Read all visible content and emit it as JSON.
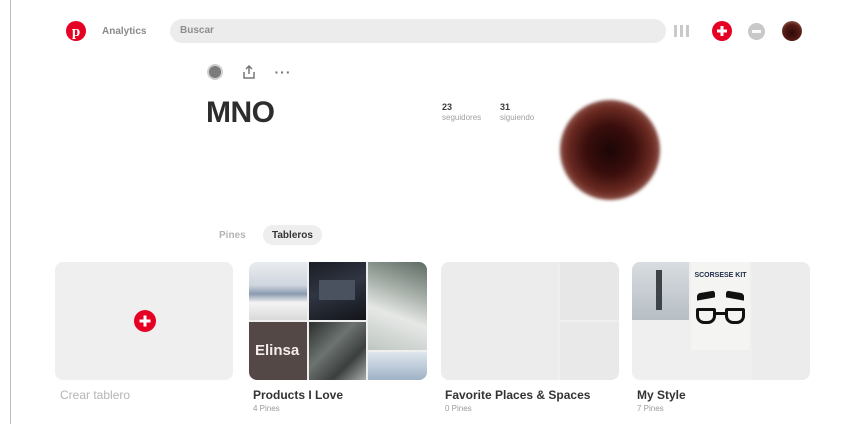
{
  "header": {
    "analytics_label": "Analytics",
    "search_placeholder": "Buscar"
  },
  "profile": {
    "name": "MNO",
    "stats": [
      {
        "value": "23",
        "label": "seguidores"
      },
      {
        "value": "31",
        "label": "siguiendo"
      }
    ],
    "more_label": "···"
  },
  "tabs": [
    {
      "label": "Pines",
      "active": false
    },
    {
      "label": "Tableros",
      "active": true
    }
  ],
  "boards": [
    {
      "title": "Crear tablero",
      "subtitle": ""
    },
    {
      "title": "Products I Love",
      "subtitle": "4 Pines",
      "cover_text": "Elinsa"
    },
    {
      "title": "Favorite Places & Spaces",
      "subtitle": "0 Pines"
    },
    {
      "title": "My Style",
      "subtitle": "7 Pines",
      "cover_text": "SCORSESE KIT"
    }
  ],
  "colors": {
    "accent": "#e60023"
  }
}
